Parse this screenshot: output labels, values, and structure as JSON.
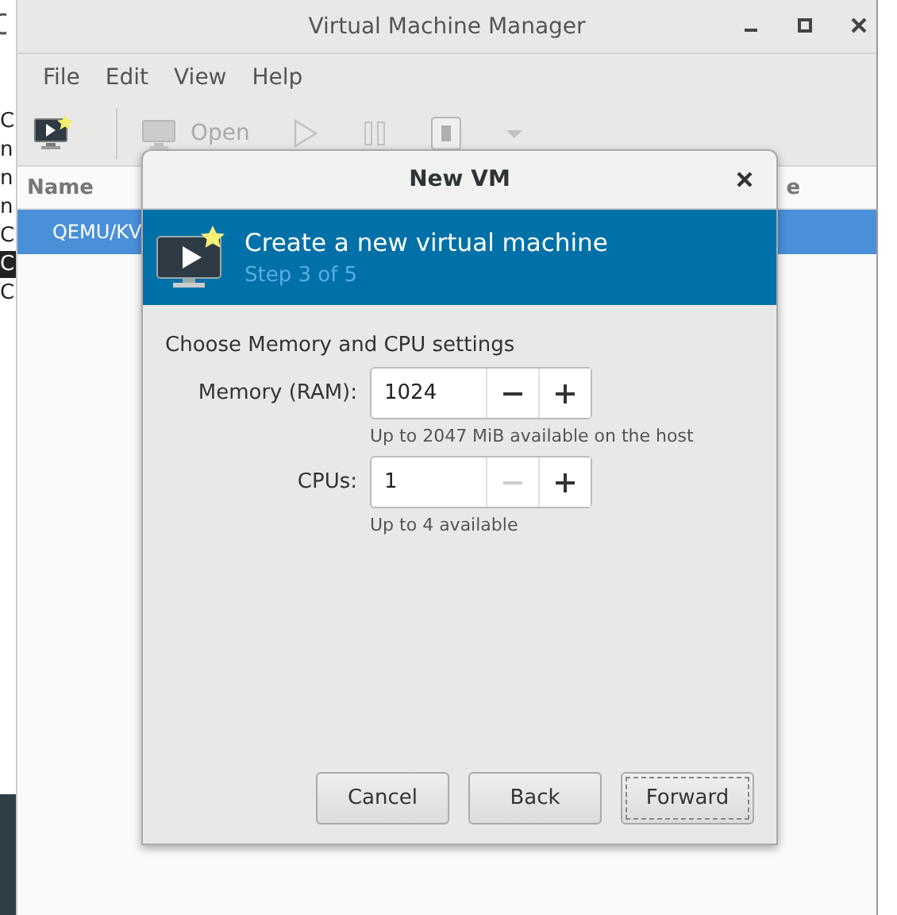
{
  "left_strip": {
    "fragments": [
      {
        "text": "C",
        "selected": false
      },
      {
        "text": "n",
        "selected": false
      },
      {
        "text": "n",
        "selected": false
      },
      {
        "text": "n",
        "selected": false
      },
      {
        "text": "C",
        "selected": false
      },
      {
        "text": "C",
        "selected": true
      },
      {
        "text": "C",
        "selected": false
      }
    ]
  },
  "window": {
    "title": "Virtual Machine Manager",
    "menu": [
      "File",
      "Edit",
      "View",
      "Help"
    ],
    "toolbar": [
      {
        "kind": "new",
        "disabled": false
      },
      {
        "kind": "separator"
      },
      {
        "kind": "open",
        "label": "Open",
        "disabled": true
      },
      {
        "kind": "play",
        "disabled": true
      },
      {
        "kind": "pause",
        "disabled": true
      },
      {
        "kind": "shutdown",
        "disabled": true
      },
      {
        "kind": "menu",
        "disabled": true
      }
    ],
    "columns": [
      "Name",
      "e"
    ],
    "rows": [
      {
        "text": "QEMU/KV",
        "selected": true
      }
    ]
  },
  "dialog": {
    "title": "New VM",
    "heading": "Create a new virtual machine",
    "step": "Step 3 of 5",
    "section": "Choose Memory and CPU settings",
    "fields": [
      {
        "label": "Memory (RAM):",
        "value": "1024",
        "minus_disabled": false,
        "plus_disabled": false,
        "hint": "Up to 2047 MiB available on the host"
      },
      {
        "label": "CPUs:",
        "value": "1",
        "minus_disabled": true,
        "plus_disabled": false,
        "hint": "Up to 4 available"
      }
    ],
    "buttons": [
      {
        "label": "Cancel",
        "focused": false
      },
      {
        "label": "Back",
        "focused": false
      },
      {
        "label": "Forward",
        "focused": true
      }
    ]
  }
}
